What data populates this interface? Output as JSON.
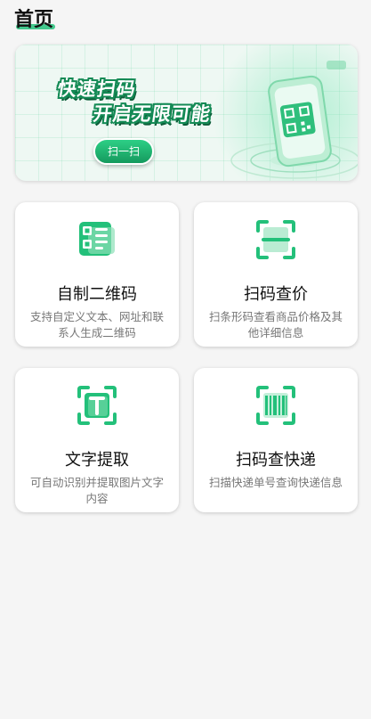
{
  "page": {
    "title": "首页"
  },
  "banner": {
    "line1": "快速扫码",
    "line2": "开启无限可能",
    "button": "扫一扫"
  },
  "cards": [
    {
      "title": "自制二维码",
      "desc": "支持自定义文本、网址和联系人生成二维码",
      "icon": "qr-generate-icon"
    },
    {
      "title": "扫码查价",
      "desc": "扫条形码查看商品价格及其他详细信息",
      "icon": "scan-frame-icon"
    },
    {
      "title": "文字提取",
      "desc": "可自动识别并提取图片文字内容",
      "icon": "text-recognition-icon"
    },
    {
      "title": "扫码查快递",
      "desc": "扫描快递单号查询快递信息",
      "icon": "barcode-scan-icon"
    }
  ],
  "colors": {
    "accent": "#23c07a",
    "accent_dark": "#148a55",
    "background": "#f5f5f5"
  }
}
